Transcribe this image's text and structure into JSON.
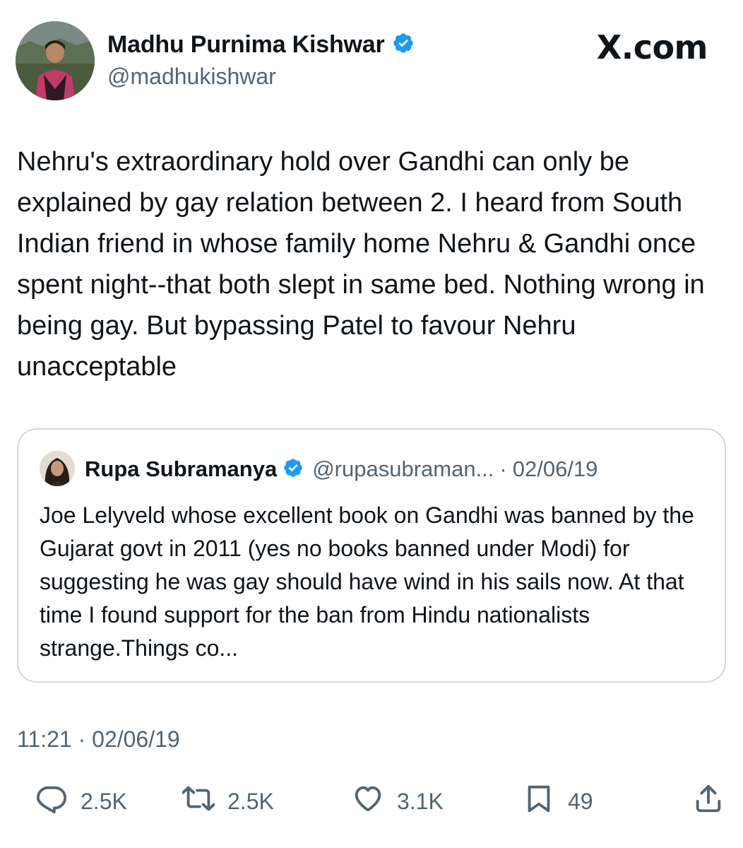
{
  "author": {
    "display_name": "Madhu Purnima Kishwar",
    "handle": "@madhukishwar",
    "verified": true
  },
  "brand": "X.com",
  "tweet": {
    "text": "Nehru's extraordinary hold over Gandhi can only be explained by gay relation between 2. I heard from South Indian friend in whose family home Nehru & Gandhi once spent night--that both slept in same bed. Nothing wrong in being gay. But bypassing Patel to favour Nehru unacceptable",
    "time": "11:21",
    "date": "02/06/19"
  },
  "quoted_tweet": {
    "display_name": "Rupa Subramanya",
    "handle": "@rupasubraman...",
    "separator": "·",
    "date": "02/06/19",
    "text": "Joe Lelyveld whose excellent book on Gandhi was banned by the Gujarat govt in 2011 (yes no books banned under Modi) for suggesting he was gay should have wind in his sails now. At that time I found support for the ban from Hindu nationalists strange.Things co..."
  },
  "metrics": {
    "replies": "2.5K",
    "reposts": "2.5K",
    "likes": "3.1K",
    "bookmarks": "49"
  },
  "colors": {
    "text": "#0f1419",
    "secondary": "#536471",
    "verified": "#1d9bf0",
    "border": "#cfd9de"
  },
  "icons": [
    "verified-badge-icon",
    "reply-icon",
    "repost-icon",
    "like-icon",
    "bookmark-icon",
    "share-icon"
  ]
}
